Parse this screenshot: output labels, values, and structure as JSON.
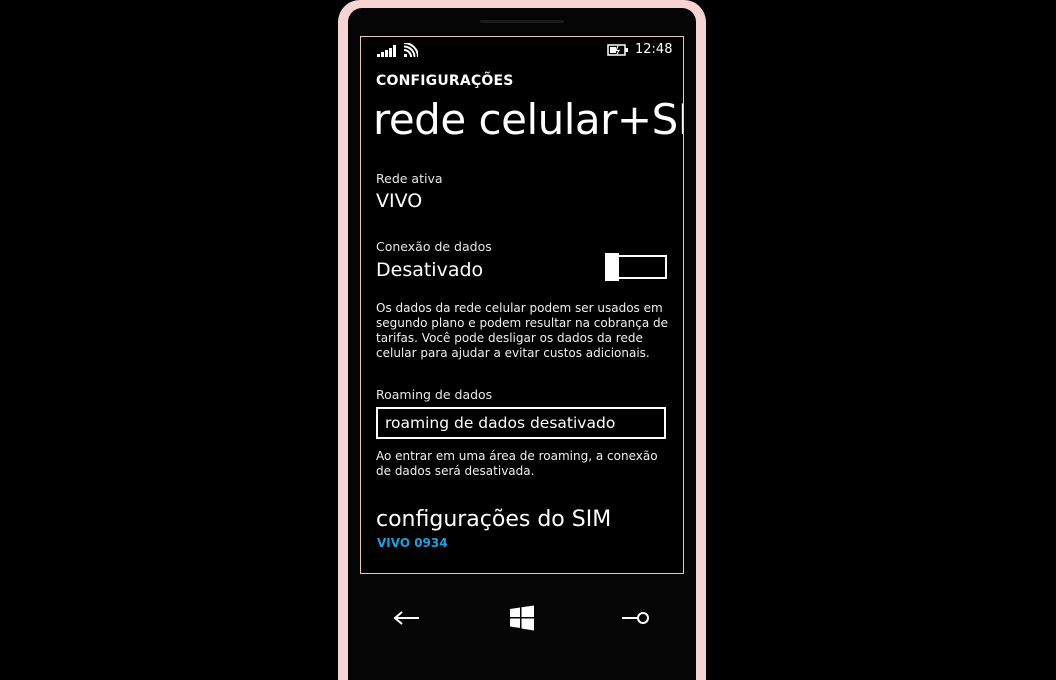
{
  "status_bar": {
    "time": "12:48",
    "icons": [
      "signal-bars-icon",
      "wifi-icon",
      "battery-charging-icon"
    ]
  },
  "header": {
    "app_title": "CONFIGURAÇÕES",
    "page_title": "rede celular+SIM"
  },
  "active_network": {
    "label": "Rede ativa",
    "value": "VIVO"
  },
  "data_connection": {
    "label": "Conexão de dados",
    "value": "Desativado",
    "toggle_state": "off",
    "description": "Os dados da rede celular podem ser usados em segundo plano e podem resultar na cobrança de tarifas. Você pode desligar os dados da rede celular para ajudar a evitar custos adicionais."
  },
  "data_roaming": {
    "label": "Roaming de dados",
    "selected": "roaming de dados desativado",
    "description": "Ao entrar em uma área de roaming, a conexão de dados será desativada."
  },
  "sim_settings": {
    "title": "configurações do SIM",
    "subtitle": "VIVO 0934"
  },
  "hardware_buttons": [
    "back-arrow-icon",
    "windows-start-icon",
    "search-icon"
  ],
  "colors": {
    "accent": "#1ba1e2",
    "frame": "#f7d3d3",
    "background": "#000000",
    "text": "#ffffff"
  }
}
